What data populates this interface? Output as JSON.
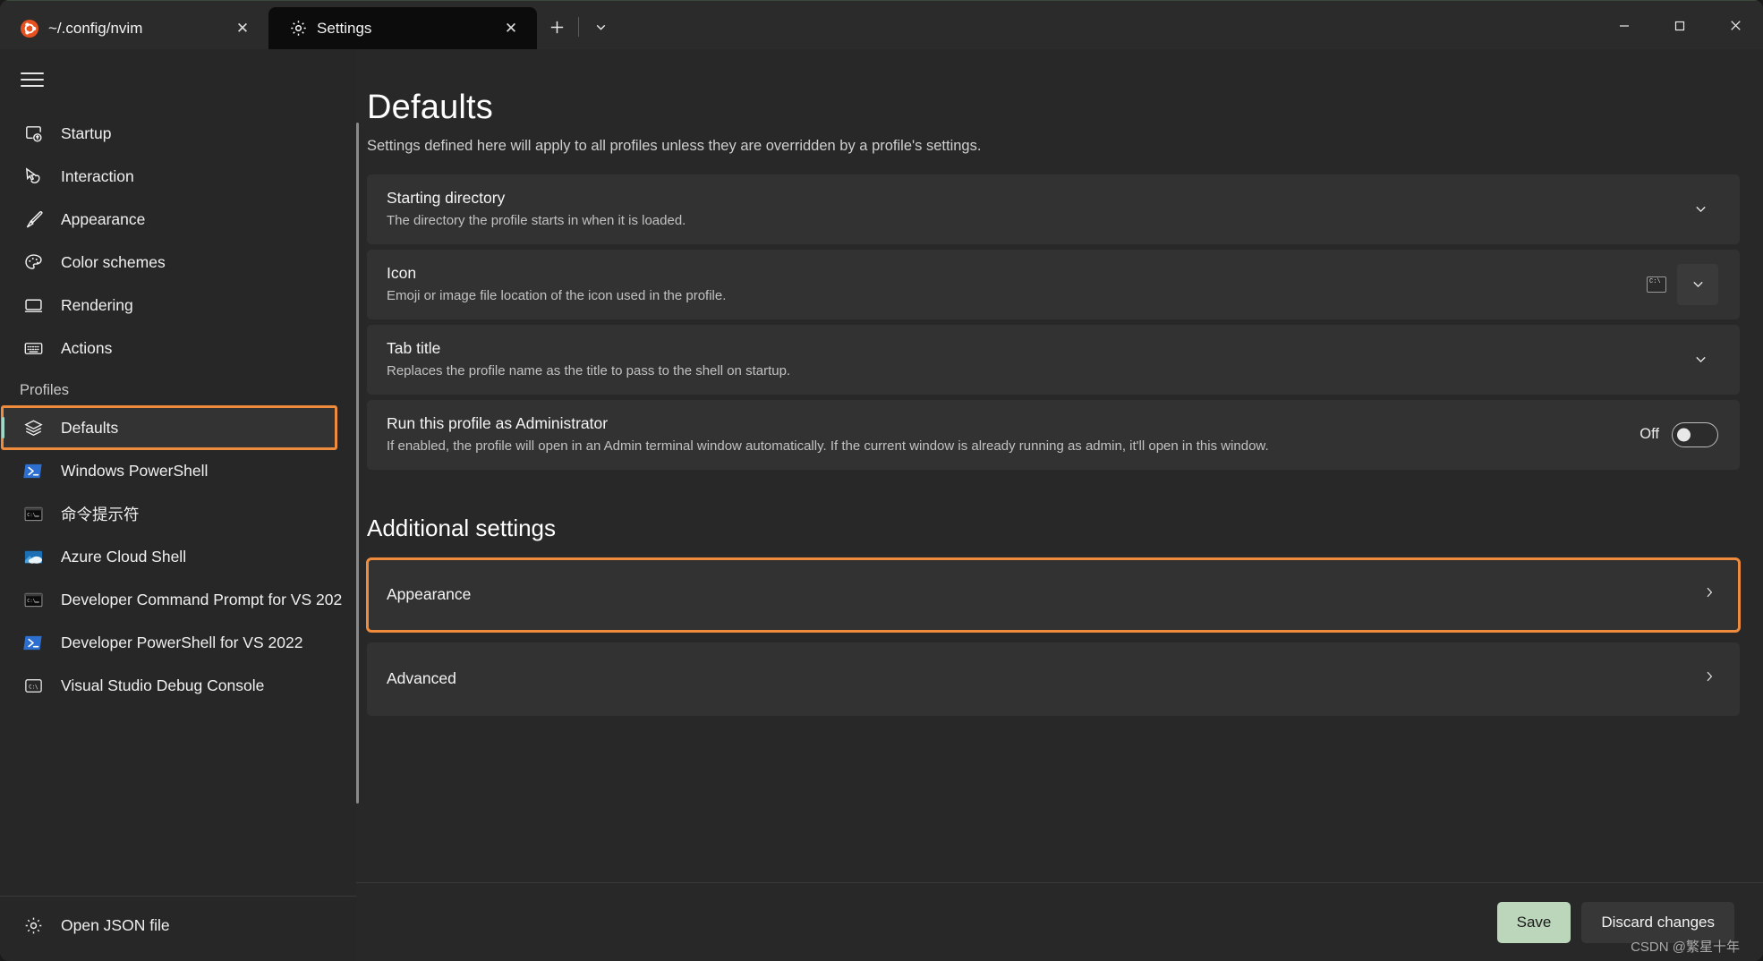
{
  "titlebar": {
    "tabs": [
      {
        "title": "~/.config/nvim",
        "icon": "ubuntu-icon",
        "active": false,
        "close_label": "✕"
      },
      {
        "title": "Settings",
        "icon": "gear-icon",
        "active": true,
        "close_label": "✕"
      }
    ],
    "new_tab_label": "+",
    "dropdown_label": "⌄",
    "window_controls": {
      "minimize": "─",
      "maximize": "□",
      "close": "✕"
    }
  },
  "sidebar": {
    "menu_label": "menu",
    "items": [
      {
        "label": "Startup",
        "icon": "startup-icon"
      },
      {
        "label": "Interaction",
        "icon": "cursor-icon"
      },
      {
        "label": "Appearance",
        "icon": "brush-icon"
      },
      {
        "label": "Color schemes",
        "icon": "palette-icon"
      },
      {
        "label": "Rendering",
        "icon": "monitor-icon"
      },
      {
        "label": "Actions",
        "icon": "keyboard-icon"
      }
    ],
    "profiles_header": "Profiles",
    "profiles": [
      {
        "label": "Defaults",
        "icon": "layers-icon",
        "selected": true
      },
      {
        "label": "Windows PowerShell",
        "icon": "powershell-icon",
        "selected": false
      },
      {
        "label": "命令提示符",
        "icon": "cmd-icon",
        "selected": false
      },
      {
        "label": "Azure Cloud Shell",
        "icon": "azure-icon",
        "selected": false
      },
      {
        "label": "Developer Command Prompt for VS 202",
        "icon": "cmd-icon",
        "selected": false
      },
      {
        "label": "Developer PowerShell for VS 2022",
        "icon": "powershell-icon",
        "selected": false
      },
      {
        "label": "Visual Studio Debug Console",
        "icon": "console-icon",
        "selected": false
      }
    ],
    "footer": {
      "label": "Open JSON file",
      "icon": "gear-icon"
    }
  },
  "main": {
    "title": "Defaults",
    "subtitle": "Settings defined here will apply to all profiles unless they are overridden by a profile's settings.",
    "settings": [
      {
        "title": "Starting directory",
        "desc": "The directory the profile starts in when it is loaded.",
        "control": "chevron",
        "chevron": "⌄"
      },
      {
        "title": "Icon",
        "desc": "Emoji or image file location of the icon used in the profile.",
        "control": "icon-preview-chevron",
        "preview": "C:\\",
        "chevron": "⌄"
      },
      {
        "title": "Tab title",
        "desc": "Replaces the profile name as the title to pass to the shell on startup.",
        "control": "chevron",
        "chevron": "⌄"
      },
      {
        "title": "Run this profile as Administrator",
        "desc": "If enabled, the profile will open in an Admin terminal window automatically. If the current window is already running as admin, it'll open in this window.",
        "control": "toggle",
        "toggle_state": "Off"
      }
    ],
    "additional_settings_header": "Additional settings",
    "additional": [
      {
        "title": "Appearance",
        "chevron": "›",
        "highlighted": true
      },
      {
        "title": "Advanced",
        "chevron": "›",
        "highlighted": false
      }
    ]
  },
  "footer": {
    "save_label": "Save",
    "discard_label": "Discard changes",
    "watermark": "CSDN @繁星十年"
  },
  "colors": {
    "accent_orange": "#ef8b3c",
    "save_green": "#bcd6bc",
    "card_bg": "#323232",
    "sidebar_bg": "#272727",
    "main_bg": "#282828"
  }
}
